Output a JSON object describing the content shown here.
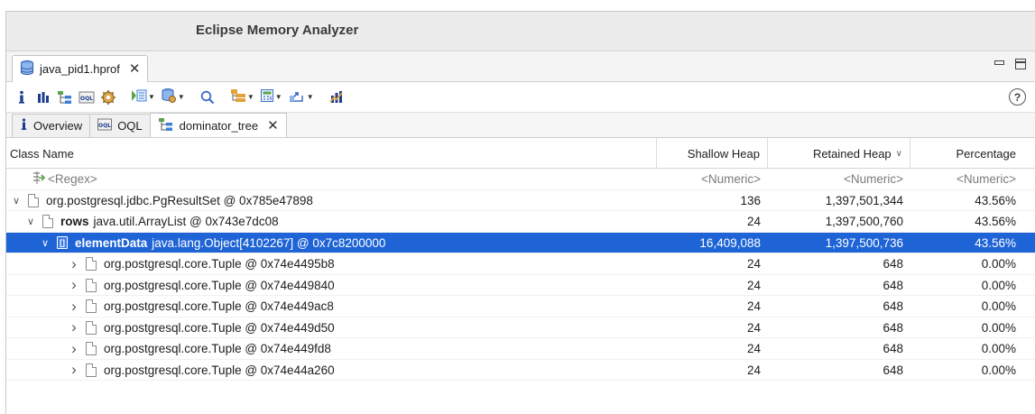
{
  "window": {
    "title": "Eclipse Memory Analyzer"
  },
  "editor_tab": {
    "label": "java_pid1.hprof",
    "close": "✕",
    "icon": "database-icon"
  },
  "toolbar": {
    "icons": [
      "info-icon",
      "histogram-icon",
      "dominator-tree-icon",
      "oql-icon",
      "heap-dump-overview-icon",
      "run-report-icon",
      "query-browser-icon",
      "search-icon",
      "group-icon",
      "calculate-retained-icon",
      "export-icon",
      "pin-icon",
      "help-icon"
    ],
    "help_label": "?"
  },
  "view_tabs": [
    {
      "label": "Overview",
      "icon": "info-icon",
      "active": false
    },
    {
      "label": "OQL",
      "icon": "oql-icon",
      "active": false
    },
    {
      "label": "dominator_tree",
      "icon": "dominator-tree-icon",
      "active": true,
      "close": "✕"
    }
  ],
  "columns": {
    "class_name": "Class Name",
    "shallow_heap": "Shallow Heap",
    "retained_heap": "Retained Heap",
    "percentage": "Percentage"
  },
  "regex_row": {
    "name": "<Regex>",
    "shallow": "<Numeric>",
    "retained": "<Numeric>",
    "pct": "<Numeric>"
  },
  "rows": [
    {
      "depth": 0,
      "expanded": true,
      "icon": "object-icon",
      "prefix": "",
      "name": "org.postgresql.jdbc.PgResultSet @ 0x785e47898",
      "shallow": "136",
      "retained": "1,397,501,344",
      "pct": "43.56%",
      "selected": false
    },
    {
      "depth": 1,
      "expanded": true,
      "icon": "object-icon",
      "prefix": "rows",
      "name": "java.util.ArrayList @ 0x743e7dc08",
      "shallow": "24",
      "retained": "1,397,500,760",
      "pct": "43.56%",
      "selected": false
    },
    {
      "depth": 2,
      "expanded": true,
      "icon": "array-icon",
      "prefix": "elementData",
      "name": "java.lang.Object[4102267] @ 0x7c8200000",
      "shallow": "16,409,088",
      "retained": "1,397,500,736",
      "pct": "43.56%",
      "selected": true
    },
    {
      "depth": 3,
      "expanded": false,
      "icon": "object-icon",
      "prefix": "",
      "name": "org.postgresql.core.Tuple @ 0x74e4495b8",
      "shallow": "24",
      "retained": "648",
      "pct": "0.00%",
      "selected": false
    },
    {
      "depth": 3,
      "expanded": false,
      "icon": "object-icon",
      "prefix": "",
      "name": "org.postgresql.core.Tuple @ 0x74e449840",
      "shallow": "24",
      "retained": "648",
      "pct": "0.00%",
      "selected": false
    },
    {
      "depth": 3,
      "expanded": false,
      "icon": "object-icon",
      "prefix": "",
      "name": "org.postgresql.core.Tuple @ 0x74e449ac8",
      "shallow": "24",
      "retained": "648",
      "pct": "0.00%",
      "selected": false
    },
    {
      "depth": 3,
      "expanded": false,
      "icon": "object-icon",
      "prefix": "",
      "name": "org.postgresql.core.Tuple @ 0x74e449d50",
      "shallow": "24",
      "retained": "648",
      "pct": "0.00%",
      "selected": false
    },
    {
      "depth": 3,
      "expanded": false,
      "icon": "object-icon",
      "prefix": "",
      "name": "org.postgresql.core.Tuple @ 0x74e449fd8",
      "shallow": "24",
      "retained": "648",
      "pct": "0.00%",
      "selected": false
    },
    {
      "depth": 3,
      "expanded": false,
      "icon": "object-icon",
      "prefix": "",
      "name": "org.postgresql.core.Tuple @ 0x74e44a260",
      "shallow": "24",
      "retained": "648",
      "pct": "0.00%",
      "selected": false
    }
  ],
  "sort_indicator": "∨",
  "colors": {
    "selection": "#1f64d6",
    "titlebar": "#ececec"
  }
}
